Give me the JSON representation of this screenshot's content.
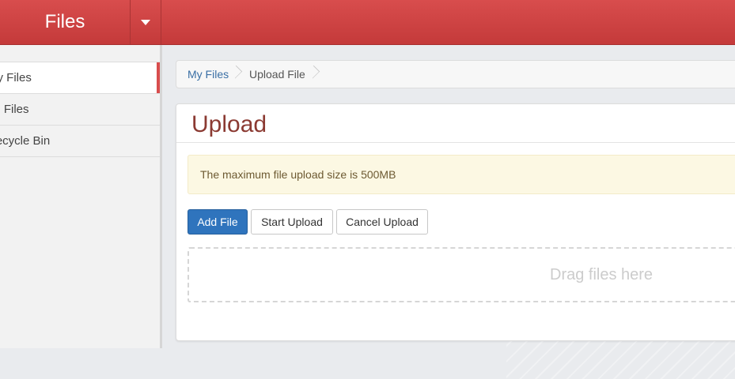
{
  "header": {
    "title": "Files"
  },
  "sidebar": {
    "items": [
      {
        "label": "My Files"
      },
      {
        "label": "All Files"
      },
      {
        "label": "Recycle Bin"
      }
    ]
  },
  "breadcrumb": {
    "items": [
      {
        "label": "My Files"
      },
      {
        "label": "Upload File"
      }
    ]
  },
  "upload": {
    "title": "Upload",
    "alert_text": "The maximum file upload size is 500MB",
    "buttons": {
      "add_file": "Add File",
      "start_upload": "Start Upload",
      "cancel_upload": "Cancel Upload"
    },
    "dropzone_text": "Drag files here"
  },
  "colors": {
    "header_red": "#d84d4d",
    "primary_blue": "#2f74bd",
    "title_color": "#8b3a32",
    "alert_bg": "#fcf8e3"
  }
}
